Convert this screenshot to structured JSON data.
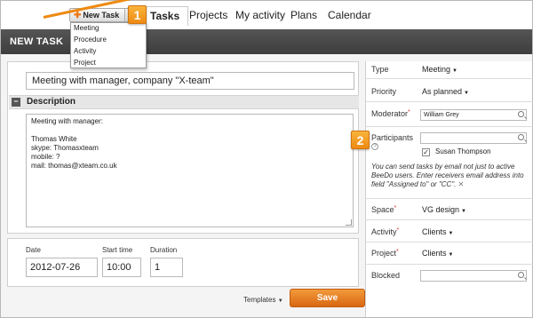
{
  "nav": {
    "new_task_label": "New Task",
    "tabs": [
      {
        "label": "Tasks"
      },
      {
        "label": "Projects"
      },
      {
        "label": "My activity"
      },
      {
        "label": "Plans"
      },
      {
        "label": "Calendar"
      }
    ]
  },
  "dropdown": {
    "items": [
      "Meeting",
      "Procedure",
      "Activity",
      "Project"
    ]
  },
  "callouts": [
    "1",
    "2"
  ],
  "header": {
    "title": "NEW TASK"
  },
  "form": {
    "subject": "Meeting with manager, company \"X-team\"",
    "description_label": "Description",
    "description_text": "Meeting with manager:\n\nThomas White\nskype: Thomasxteam\nmobile: ?\nmail: thomas@xteam.co.uk",
    "date_label": "Date",
    "date_value": "2012-07-26",
    "start_label": "Start time",
    "start_value": "10:00",
    "duration_label": "Duration",
    "duration_value": "1",
    "templates_label": "Templates",
    "save_label": "Save"
  },
  "side": {
    "type_label": "Type",
    "type_value": "Meeting",
    "priority_label": "Priority",
    "priority_value": "As planned",
    "moderator_label": "Moderator",
    "moderator_value": "William Grey",
    "participants_label": "Participants",
    "participant_name": "Susan Thompson",
    "hint": "You can send tasks by email not just to active BeeDo users. Enter receivers email address into field \"Assigned to\" or \"CC\".",
    "space_label": "Space",
    "space_value": "VG design",
    "activity_label": "Activity",
    "activity_value": "Clients",
    "project_label": "Project",
    "project_value": "Clients",
    "blocked_label": "Blocked"
  },
  "colors": {
    "accent": "#ee8a12",
    "header": "#454545"
  }
}
